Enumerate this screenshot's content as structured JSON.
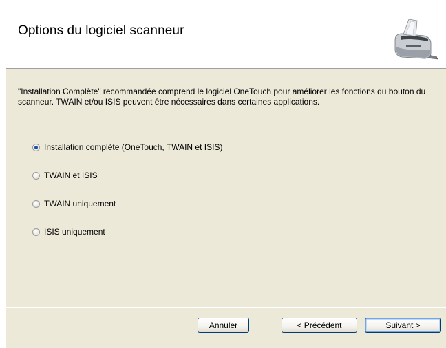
{
  "header": {
    "title": "Options du logiciel scanneur",
    "icon": "scanner-icon"
  },
  "description": "\"Installation Complète\" recommandée comprend le logiciel OneTouch pour améliorer les fonctions du bouton du scanneur. TWAIN et/ou ISIS peuvent être nécessaires dans certaines applications.",
  "options": [
    {
      "label": "Installation complète (OneTouch, TWAIN et ISIS)",
      "selected": true
    },
    {
      "label": "TWAIN et ISIS",
      "selected": false
    },
    {
      "label": "TWAIN uniquement",
      "selected": false
    },
    {
      "label": "ISIS uniquement",
      "selected": false
    }
  ],
  "buttons": {
    "cancel_label": "Annuler",
    "back_label": "< Précédent",
    "next_label": "Suivant >"
  },
  "colors": {
    "dialog_background": "#ece9d8",
    "header_background": "#ffffff",
    "radio_selected_dot": "#1d4fa8",
    "button_border": "#003c74",
    "default_button_focus": "#6fa6e8"
  }
}
